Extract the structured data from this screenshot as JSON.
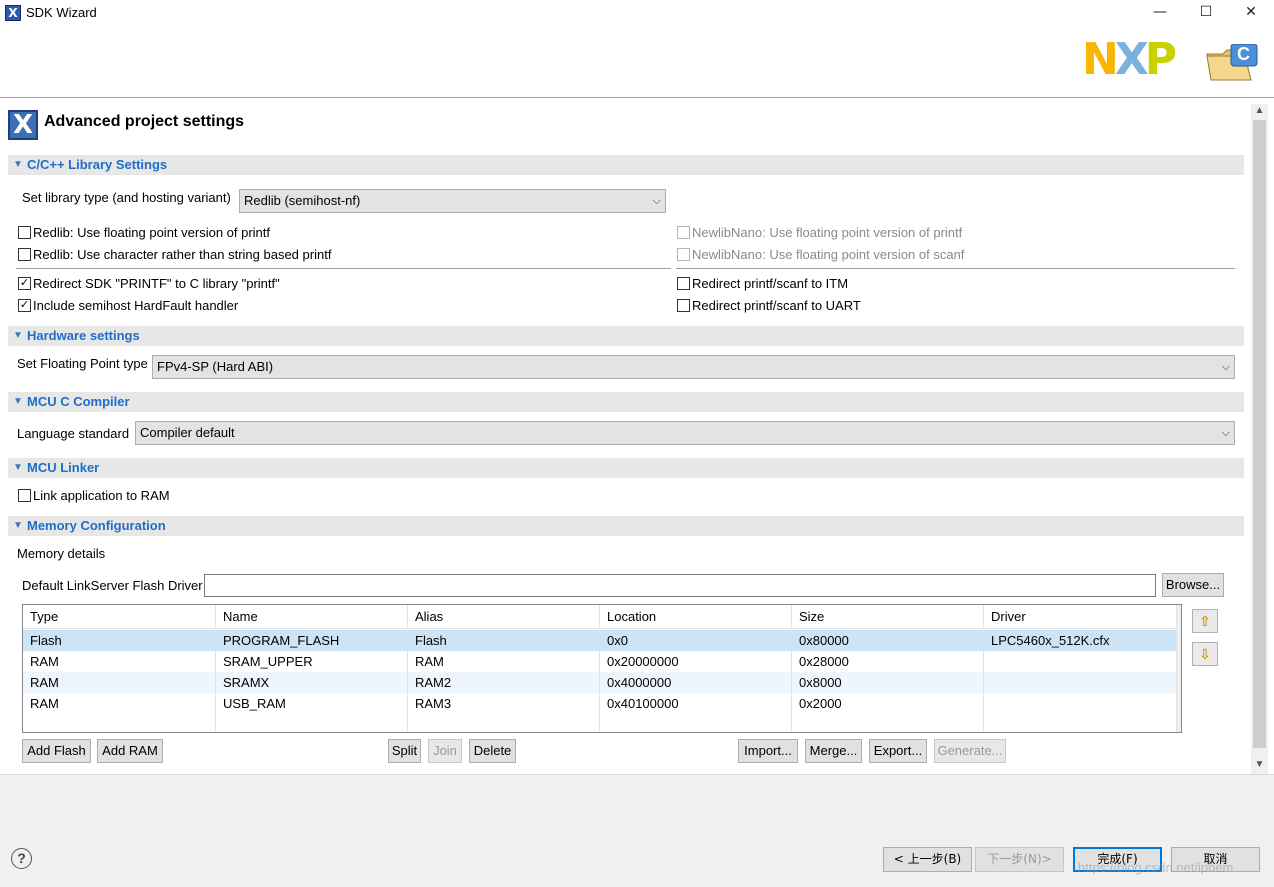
{
  "window": {
    "title": "SDK Wizard",
    "icon": "sdk-wizard-x-icon",
    "controls": {
      "minimize": "—",
      "maximize": "☐",
      "close": "✕"
    }
  },
  "banner": {
    "logo_letters": [
      "N",
      "X",
      "P"
    ],
    "logo_colors": [
      "#f9b500",
      "#7bb1db",
      "#c9d200"
    ],
    "folder_glyph": "C"
  },
  "page": {
    "title": "Advanced project settings"
  },
  "sections": {
    "library": "C/C++ Library Settings",
    "hardware": "Hardware settings",
    "compiler": "MCU C Compiler",
    "linker": "MCU Linker",
    "memory": "Memory Configuration"
  },
  "library": {
    "type_label": "Set library type (and hosting variant)",
    "type_value": "Redlib (semihost-nf)",
    "options_left": [
      {
        "label": "Redlib: Use floating point version of printf",
        "checked": false
      },
      {
        "label": "Redlib: Use character rather than string based printf",
        "checked": false
      },
      {
        "label": "Redirect SDK \"PRINTF\" to C library \"printf\"",
        "checked": true
      },
      {
        "label": "Include semihost HardFault handler",
        "checked": true
      }
    ],
    "options_right": [
      {
        "label": "NewlibNano: Use floating point version of printf",
        "checked": false,
        "disabled": true
      },
      {
        "label": "NewlibNano: Use floating point version of scanf",
        "checked": false,
        "disabled": true
      },
      {
        "label": "Redirect printf/scanf to ITM",
        "checked": false
      },
      {
        "label": "Redirect printf/scanf to UART",
        "checked": false
      }
    ]
  },
  "hardware": {
    "fp_label": "Set Floating Point type",
    "fp_value": "FPv4-SP (Hard ABI)"
  },
  "compiler": {
    "lang_label": "Language standard",
    "lang_value": "Compiler default"
  },
  "linker": {
    "ram_label": "Link application to RAM",
    "ram_checked": false
  },
  "memory": {
    "details_label": "Memory details",
    "flash_driver_label": "Default LinkServer Flash Driver",
    "flash_driver_value": "",
    "browse": "Browse...",
    "columns": [
      "Type",
      "Name",
      "Alias",
      "Location",
      "Size",
      "Driver"
    ],
    "rows": [
      [
        "Flash",
        "PROGRAM_FLASH",
        "Flash",
        "0x0",
        "0x80000",
        "LPC5460x_512K.cfx"
      ],
      [
        "RAM",
        "SRAM_UPPER",
        "RAM",
        "0x20000000",
        "0x28000",
        ""
      ],
      [
        "RAM",
        "SRAMX",
        "RAM2",
        "0x4000000",
        "0x8000",
        ""
      ],
      [
        "RAM",
        "USB_RAM",
        "RAM3",
        "0x40100000",
        "0x2000",
        ""
      ]
    ],
    "buttons": {
      "add_flash": "Add Flash",
      "add_ram": "Add RAM",
      "split": "Split",
      "join": "Join",
      "delete": "Delete",
      "import": "Import...",
      "merge": "Merge...",
      "export": "Export...",
      "generate": "Generate..."
    }
  },
  "dialog": {
    "help": "?",
    "back": "< 上一步(B)",
    "next": "下一步(N)>",
    "finish": "完成(F)",
    "cancel": "取消"
  },
  "watermark": "https://blog.csdn.net/ipoem"
}
